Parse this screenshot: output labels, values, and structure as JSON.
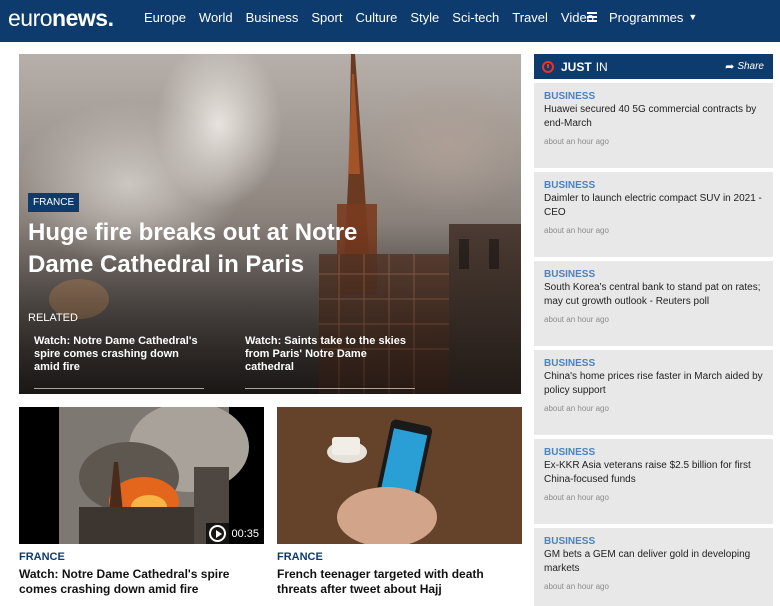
{
  "logo": {
    "part1": "euro",
    "part2": "news",
    "dot": "."
  },
  "nav": {
    "items": [
      "Europe",
      "World",
      "Business",
      "Sport",
      "Culture",
      "Style",
      "Sci-tech",
      "Travel",
      "Video"
    ]
  },
  "programmes": {
    "label": "Programmes"
  },
  "hero": {
    "tag": "FRANCE",
    "title": "Huge fire breaks out at Notre Dame Cathedral in Paris",
    "related_label": "RELATED",
    "related": [
      "Watch: Notre Dame Cathedral's spire comes crashing down amid fire",
      "Watch: Saints take to the skies from Paris' Notre Dame cathedral"
    ]
  },
  "cards": [
    {
      "category": "FRANCE",
      "title": "Watch: Notre Dame Cathedral's spire comes crashing down amid fire",
      "duration": "00:35"
    },
    {
      "category": "FRANCE",
      "title": "French teenager targeted with death threats after tweet about Hajj"
    }
  ],
  "just_in": {
    "label_just": "JUST",
    "label_in": "IN",
    "share": "Share",
    "items": [
      {
        "category": "BUSINESS",
        "title": "Huawei secured 40 5G commercial contracts by end-March",
        "time": "about an hour ago"
      },
      {
        "category": "BUSINESS",
        "title": "Daimler to launch electric compact SUV in 2021 - CEO",
        "time": "about an hour ago"
      },
      {
        "category": "BUSINESS",
        "title": "South Korea's central bank to stand pat on rates; may cut growth outlook - Reuters poll",
        "time": "about an hour ago"
      },
      {
        "category": "BUSINESS",
        "title": "China's home prices rise faster in March aided by policy support",
        "time": "about an hour ago"
      },
      {
        "category": "BUSINESS",
        "title": "Ex-KKR Asia veterans raise $2.5 billion for first China-focused funds",
        "time": "about an hour ago"
      },
      {
        "category": "BUSINESS",
        "title": "GM bets a GEM can deliver gold in developing markets",
        "time": "about an hour ago"
      }
    ]
  },
  "colors": {
    "brand": "#0d3b6e",
    "accent": "#4a82c2",
    "live": "#e32222"
  }
}
